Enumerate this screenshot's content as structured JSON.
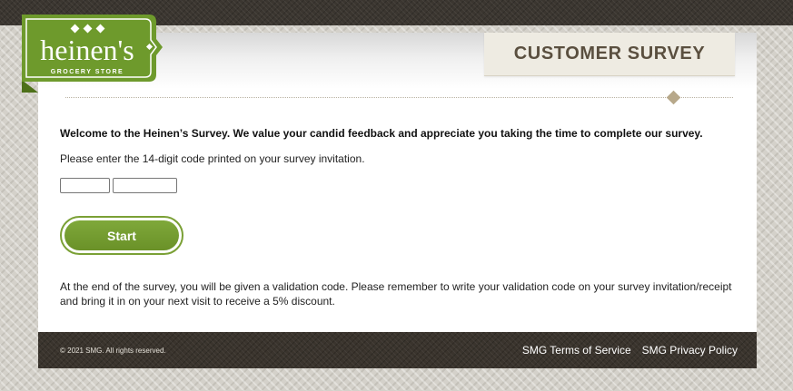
{
  "logo": {
    "name": "heinen's",
    "tagline": "GROCERY STORE",
    "brand_color": "#6e9a2c"
  },
  "header": {
    "title": "CUSTOMER SURVEY"
  },
  "main": {
    "welcome": "Welcome to the Heinen’s Survey. We value your candid feedback and appreciate you taking the time to complete our survey.",
    "instruction": "Please enter the 14-digit code printed on your survey invitation.",
    "code_part1": {
      "value": "",
      "placeholder": ""
    },
    "code_part2": {
      "value": "",
      "placeholder": ""
    },
    "start_label": "Start",
    "end_note": "At the end of the survey, you will be given a validation code. Please remember to write your validation code on your survey invitation/receipt and bring it in on your next visit to receive a 5% discount."
  },
  "footer": {
    "copyright": "© 2021 SMG. All rights reserved.",
    "links": [
      "SMG Terms of Service",
      "SMG Privacy Policy"
    ]
  },
  "colors": {
    "accent_green": "#7aa035",
    "header_text": "#5a4f3f",
    "footer_bg": "#3a342d"
  }
}
